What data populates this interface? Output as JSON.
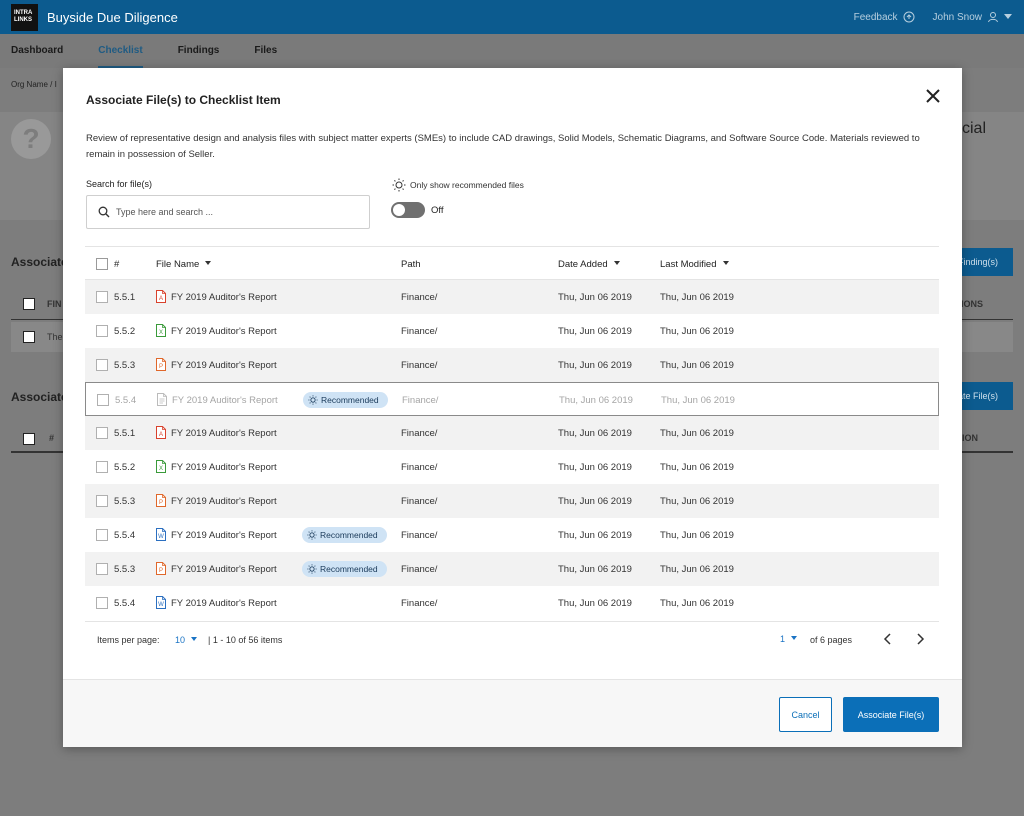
{
  "app": {
    "logo_line1": "INTRA",
    "logo_line2": "LINKS",
    "title": "Buyside Due Diligence",
    "feedback": "Feedback",
    "user": "John Snow"
  },
  "nav": {
    "tabs": [
      "Dashboard",
      "Checklist",
      "Findings",
      "Files"
    ],
    "active": "Checklist"
  },
  "background": {
    "breadcrumb": "Org Name  /  I",
    "partial_title": "cial",
    "section1": "Associate",
    "section1_button": "Finding(s)",
    "section1_col1": "FIN",
    "section1_col_right": "IONS",
    "section1_row": "The",
    "section2": "Associate",
    "section2_button": "ate File(s)",
    "section2_col1": "#",
    "section2_col_right": "ION"
  },
  "modal": {
    "title": "Associate File(s) to Checklist Item",
    "description": "Review of representative design and analysis files with subject matter experts (SMEs) to include CAD drawings, Solid Models, Schematic Diagrams, and Software Source Code. Materials reviewed to remain in possession of Seller.",
    "search_label": "Search for file(s)",
    "search_placeholder": "Type here and search ...",
    "recommended_label": "Only show recommended files",
    "toggle_state": "Off",
    "columns": {
      "num": "#",
      "file_name": "File Name",
      "path": "Path",
      "date_added": "Date Added",
      "last_modified": "Last Modified"
    },
    "badge_label": "Recommended",
    "rows": [
      {
        "num": "5.5.1",
        "icon": "pdf-file-icon",
        "color": "#d9412c",
        "name": "FY 2019 Auditor's Report",
        "recommended": false,
        "path": "Finance/",
        "date_added": "Thu, Jun 06 2019",
        "last_modified": "Thu, Jun 06 2019"
      },
      {
        "num": "5.5.2",
        "icon": "excel-file-icon",
        "color": "#3a9a3a",
        "name": "FY 2019 Auditor's Report",
        "recommended": false,
        "path": "Finance/",
        "date_added": "Thu, Jun 06 2019",
        "last_modified": "Thu, Jun 06 2019"
      },
      {
        "num": "5.5.3",
        "icon": "ppt-file-icon",
        "color": "#e0672a",
        "name": "FY 2019 Auditor's Report",
        "recommended": false,
        "path": "Finance/",
        "date_added": "Thu, Jun 06 2019",
        "last_modified": "Thu, Jun 06 2019"
      },
      {
        "num": "5.5.4",
        "icon": "generic-file-icon",
        "color": "#b0b0b0",
        "name": "FY 2019 Auditor's Report",
        "recommended": true,
        "path": "Finance/",
        "date_added": "Thu, Jun 06 2019",
        "last_modified": "Thu, Jun 06 2019"
      },
      {
        "num": "5.5.1",
        "icon": "pdf-file-icon",
        "color": "#d9412c",
        "name": "FY 2019 Auditor's Report",
        "recommended": false,
        "path": "Finance/",
        "date_added": "Thu, Jun 06 2019",
        "last_modified": "Thu, Jun 06 2019"
      },
      {
        "num": "5.5.2",
        "icon": "excel-file-icon",
        "color": "#3a9a3a",
        "name": "FY 2019 Auditor's Report",
        "recommended": false,
        "path": "Finance/",
        "date_added": "Thu, Jun 06 2019",
        "last_modified": "Thu, Jun 06 2019"
      },
      {
        "num": "5.5.3",
        "icon": "ppt-file-icon",
        "color": "#e0672a",
        "name": "FY 2019 Auditor's Report",
        "recommended": false,
        "path": "Finance/",
        "date_added": "Thu, Jun 06 2019",
        "last_modified": "Thu, Jun 06 2019"
      },
      {
        "num": "5.5.4",
        "icon": "word-file-icon",
        "color": "#2b6fc0",
        "name": "FY 2019 Auditor's Report",
        "recommended": true,
        "path": "Finance/",
        "date_added": "Thu, Jun 06 2019",
        "last_modified": "Thu, Jun 06 2019"
      },
      {
        "num": "5.5.3",
        "icon": "ppt-file-icon",
        "color": "#e0672a",
        "name": "FY 2019 Auditor's Report",
        "recommended": true,
        "path": "Finance/",
        "date_added": "Thu, Jun 06 2019",
        "last_modified": "Thu, Jun 06 2019"
      },
      {
        "num": "5.5.4",
        "icon": "word-file-icon",
        "color": "#2b6fc0",
        "name": "FY 2019 Auditor's Report",
        "recommended": false,
        "path": "Finance/",
        "date_added": "Thu, Jun 06 2019",
        "last_modified": "Thu, Jun 06 2019"
      }
    ],
    "pagination": {
      "per_page_label": "Items per page:",
      "per_page": "10",
      "range": "|   1 - 10 of 56 items",
      "page": "1",
      "of_pages": "of 6 pages"
    },
    "buttons": {
      "cancel": "Cancel",
      "associate": "Associate File(s)"
    }
  },
  "colors": {
    "brand": "#0c5b8f",
    "primary_button": "#0b6fb8",
    "badge_bg": "#cfe3f5",
    "link": "#1a73c4"
  }
}
